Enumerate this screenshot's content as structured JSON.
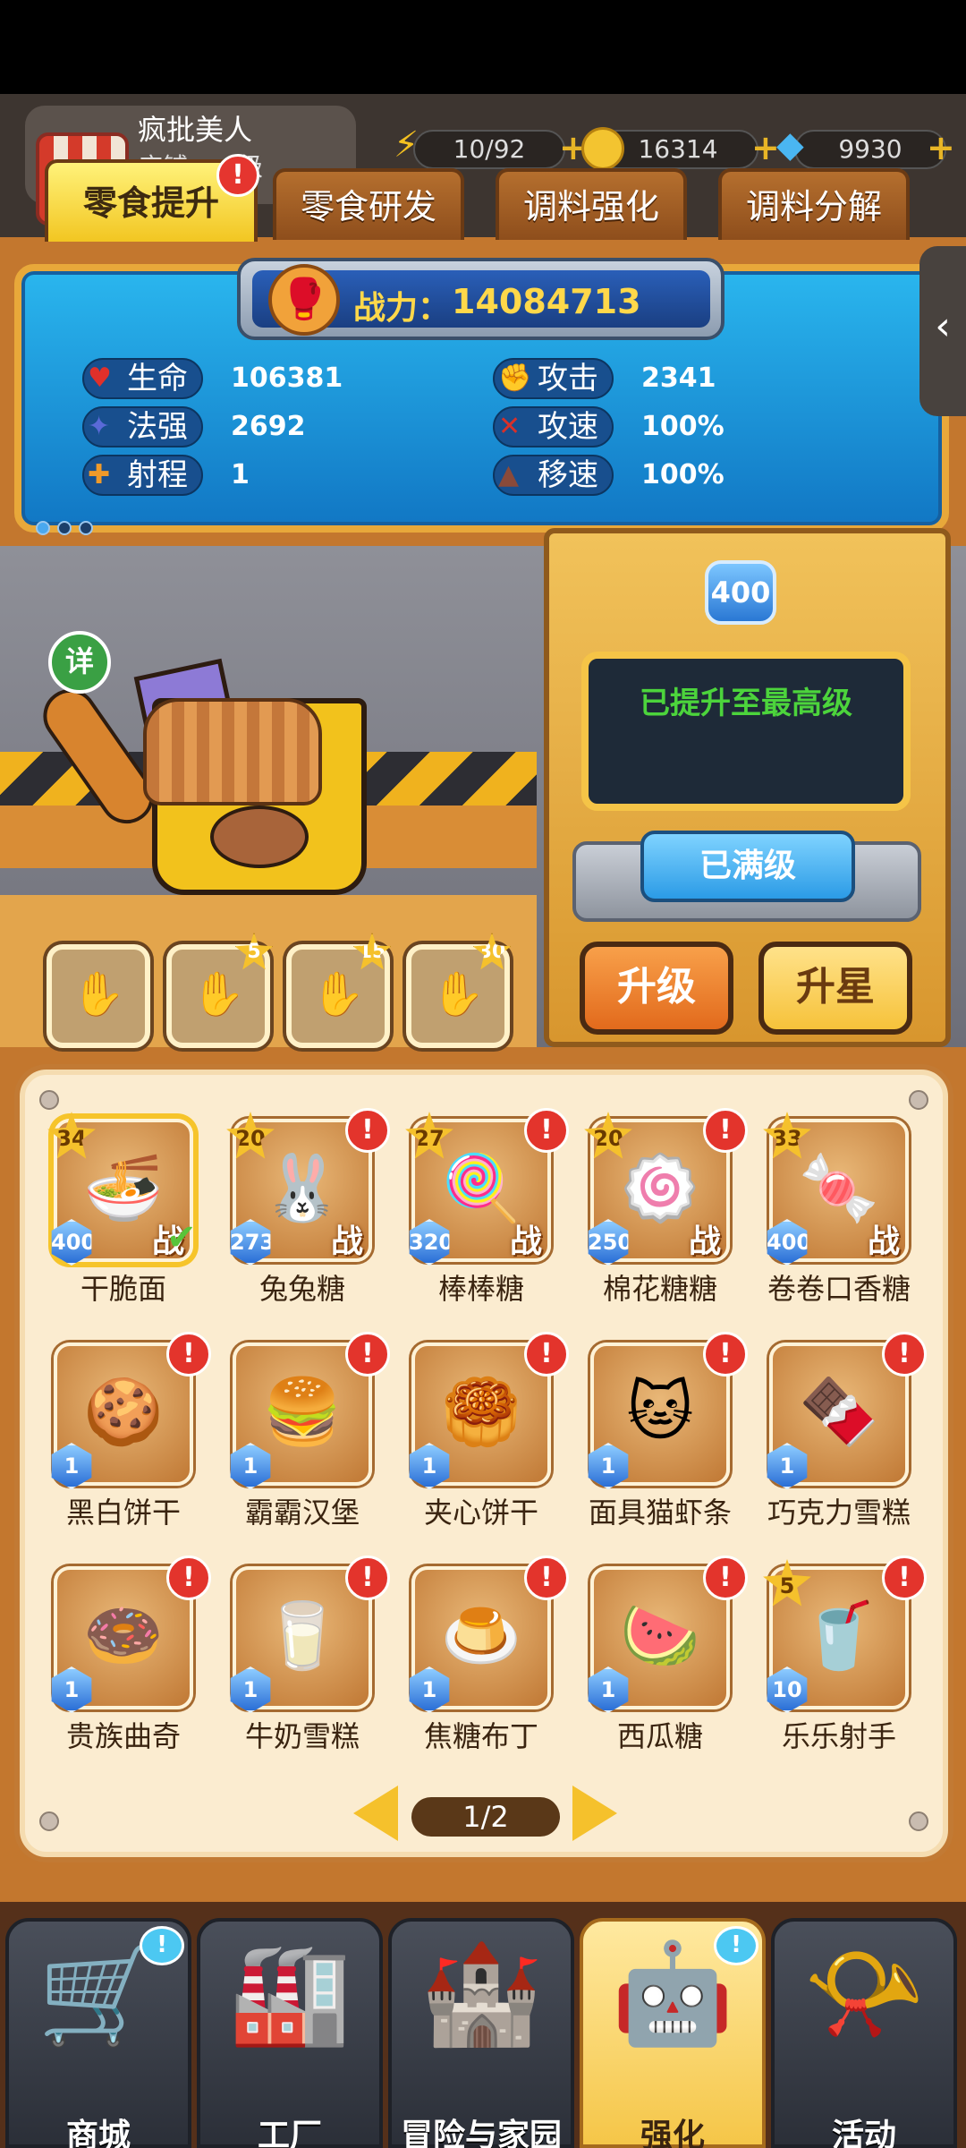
{
  "player": {
    "name": "疯批美人",
    "shop_label": "店铺：…级"
  },
  "resources": [
    {
      "icon": "lightning-icon",
      "value": "10/92"
    },
    {
      "icon": "coin-icon",
      "value": "16314"
    },
    {
      "icon": "diamond-icon",
      "value": "9930"
    }
  ],
  "tabs": [
    {
      "label": "零食提升",
      "active": true,
      "alert": "!"
    },
    {
      "label": "零食研发",
      "active": false
    },
    {
      "label": "调料强化",
      "active": false
    },
    {
      "label": "调料分解",
      "active": false
    }
  ],
  "combat_power": {
    "label": "战力：",
    "value": "14084713"
  },
  "stats": [
    {
      "label": "生命",
      "value": "106381",
      "icon": "heart-icon",
      "glyph": "♥",
      "color": "#e0302a"
    },
    {
      "label": "攻击",
      "value": "2341",
      "icon": "fist-icon",
      "glyph": "✊",
      "color": "#e0603a"
    },
    {
      "label": "法强",
      "value": "2692",
      "icon": "magic-icon",
      "glyph": "✦",
      "color": "#5a6ad8"
    },
    {
      "label": "攻速",
      "value": "100%",
      "icon": "sword-icon",
      "glyph": "✕",
      "color": "#d8302a"
    },
    {
      "label": "射程",
      "value": "1",
      "icon": "crosshair-icon",
      "glyph": "✚",
      "color": "#f09a2a"
    },
    {
      "label": "移速",
      "value": "100%",
      "icon": "boot-icon",
      "glyph": "▲",
      "color": "#8a4a3a"
    }
  ],
  "level_machine": {
    "level": "400",
    "status": "已提升至最高级",
    "max_button": "已满级"
  },
  "actions": {
    "upgrade": "升级",
    "upstar": "升星"
  },
  "hero": {
    "detail_label": "详"
  },
  "skills": [
    {
      "unlock": ""
    },
    {
      "unlock": "5"
    },
    {
      "unlock": "15"
    },
    {
      "unlock": "30"
    }
  ],
  "snacks": [
    {
      "name": "干脆面",
      "star": "34",
      "level": "400",
      "status": "战",
      "emoji": "🍜",
      "selected": true,
      "check": "✔"
    },
    {
      "name": "兔兔糖",
      "star": "20",
      "level": "273",
      "status": "战",
      "emoji": "🐰",
      "alert": "!"
    },
    {
      "name": "棒棒糖",
      "star": "27",
      "level": "320",
      "status": "战",
      "emoji": "🍭",
      "alert": "!"
    },
    {
      "name": "棉花糖糖",
      "star": "20",
      "level": "250",
      "status": "战",
      "emoji": "🍥",
      "alert": "!"
    },
    {
      "name": "卷卷口香糖",
      "star": "33",
      "level": "400",
      "status": "战",
      "emoji": "🍬"
    },
    {
      "name": "黑白饼干",
      "level": "1",
      "emoji": "🍪",
      "alert": "!"
    },
    {
      "name": "霸霸汉堡",
      "level": "1",
      "emoji": "🍔",
      "alert": "!"
    },
    {
      "name": "夹心饼干",
      "level": "1",
      "emoji": "🥮",
      "alert": "!"
    },
    {
      "name": "面具猫虾条",
      "level": "1",
      "emoji": "🐱",
      "alert": "!"
    },
    {
      "name": "巧克力雪糕",
      "level": "1",
      "emoji": "🍫",
      "alert": "!"
    },
    {
      "name": "贵族曲奇",
      "level": "1",
      "emoji": "🍩",
      "alert": "!"
    },
    {
      "name": "牛奶雪糕",
      "level": "1",
      "emoji": "🥛",
      "alert": "!"
    },
    {
      "name": "焦糖布丁",
      "level": "1",
      "emoji": "🍮",
      "alert": "!"
    },
    {
      "name": "西瓜糖",
      "level": "1",
      "emoji": "🍉",
      "alert": "!"
    },
    {
      "name": "乐乐射手",
      "star": "5",
      "level": "10",
      "emoji": "🥤",
      "alert": "!"
    }
  ],
  "pagination": {
    "label": "1/2"
  },
  "bottom_nav": [
    {
      "label": "商城",
      "icon": "shop-cart-icon",
      "emoji": "🛒",
      "chat": "!"
    },
    {
      "label": "工厂",
      "icon": "factory-icon",
      "emoji": "🏭"
    },
    {
      "label": "冒险与家园",
      "icon": "adventure-icon",
      "emoji": "🏰"
    },
    {
      "label": "强化",
      "icon": "enhance-icon",
      "emoji": "🤖",
      "active": true,
      "chat": "!"
    },
    {
      "label": "活动",
      "icon": "trumpet-icon",
      "emoji": "📯"
    }
  ]
}
